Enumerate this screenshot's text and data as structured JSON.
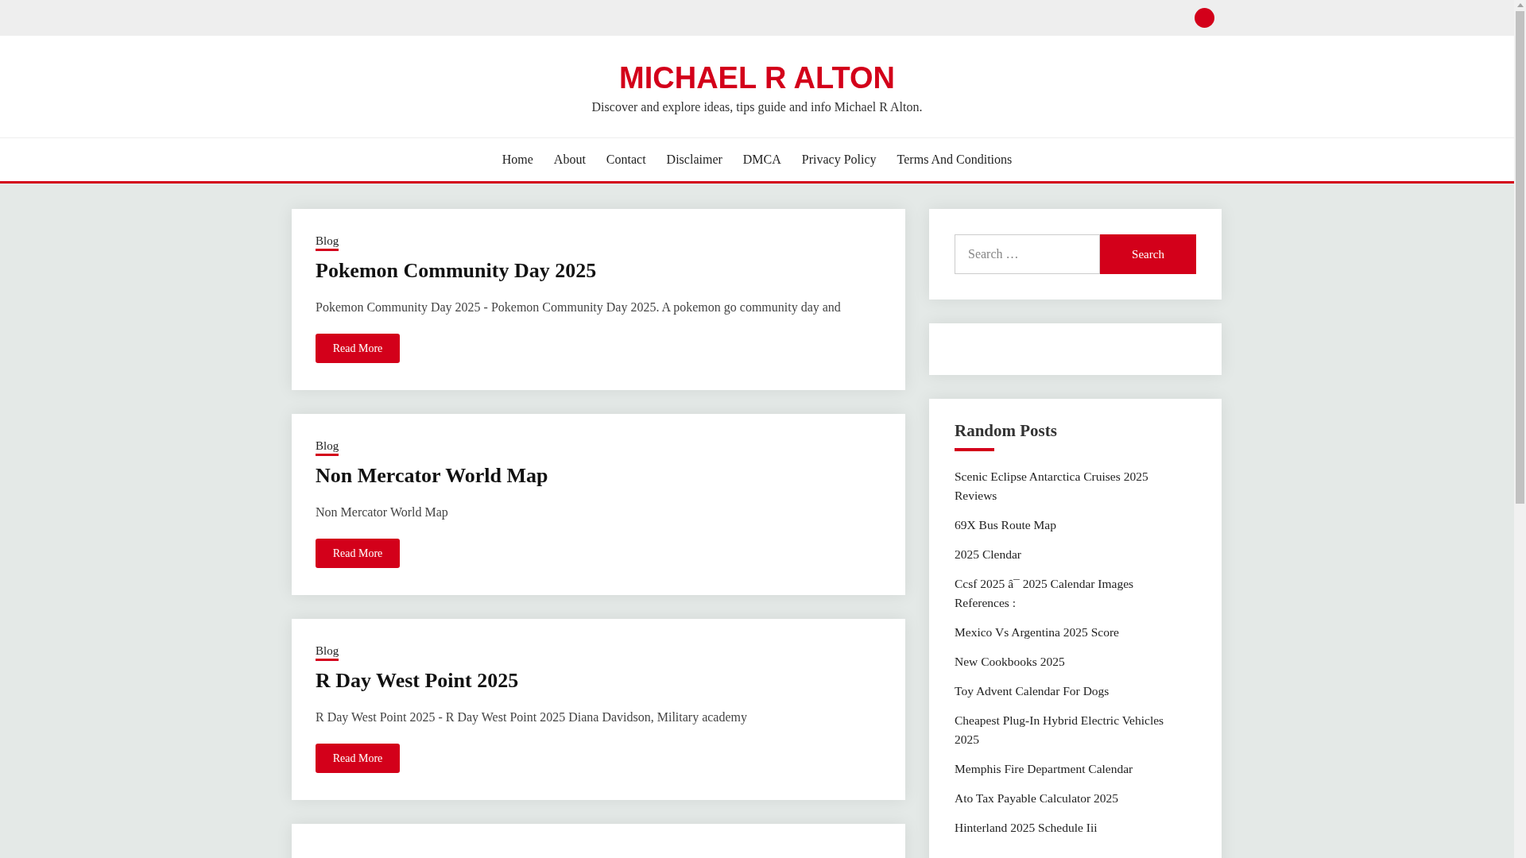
{
  "site": {
    "title": "MICHAEL R ALTON",
    "tagline": "Discover and explore ideas, tips guide and info Michael R Alton."
  },
  "nav": [
    "Home",
    "About",
    "Contact",
    "Disclaimer",
    "DMCA",
    "Privacy Policy",
    "Terms And Conditions"
  ],
  "posts": [
    {
      "category": "Blog",
      "title": "Pokemon Community Day 2025",
      "excerpt": "Pokemon Community Day 2025 - Pokemon Community Day 2025. A pokemon go community day and",
      "button": "Read More"
    },
    {
      "category": "Blog",
      "title": "Non Mercator World Map",
      "excerpt": "Non Mercator World Map",
      "button": "Read More"
    },
    {
      "category": "Blog",
      "title": "R Day West Point 2025",
      "excerpt": "R Day West Point 2025 - R Day West Point 2025 Diana Davidson, Military academy",
      "button": "Read More"
    }
  ],
  "search": {
    "placeholder": "Search …",
    "button": "Search"
  },
  "random_posts": {
    "title": "Random Posts",
    "items": [
      "Scenic Eclipse Antarctica Cruises 2025 Reviews",
      "69X Bus Route Map",
      "2025 Clendar",
      "Ccsf 2025 â¯ 2025 Calendar Images References :",
      "Mexico Vs Argentina 2025 Score",
      "New Cookbooks 2025",
      "Toy Advent Calendar For Dogs",
      "Cheapest Plug-In Hybrid Electric Vehicles 2025",
      "Memphis Fire Department Calendar",
      "Ato Tax Payable Calculator 2025",
      "Hinterland 2025 Schedule Iii"
    ]
  }
}
